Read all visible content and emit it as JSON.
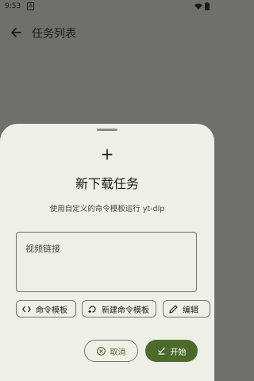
{
  "status_bar": {
    "time": "9:53",
    "notification_letter": "A"
  },
  "appbar": {
    "title": "任务列表",
    "back_icon": "arrow-back-icon"
  },
  "sheet": {
    "plus_symbol": "+",
    "title": "新下载任务",
    "subtitle": "使用自定义的命令模板运行 yt-dlp",
    "url_field": {
      "placeholder": "视频链接",
      "value": ""
    },
    "chips": [
      {
        "label": "命令模板",
        "icon": "code-icon"
      },
      {
        "label": "新建命令模板",
        "icon": "new-template-icon"
      },
      {
        "label": "编辑",
        "icon": "pencil-icon"
      }
    ],
    "cancel_label": "取消",
    "start_label": "开始"
  },
  "colors": {
    "primary": "#4b6a2b",
    "sheet_bg": "#eeefe7",
    "scrim": "#6f706b"
  }
}
